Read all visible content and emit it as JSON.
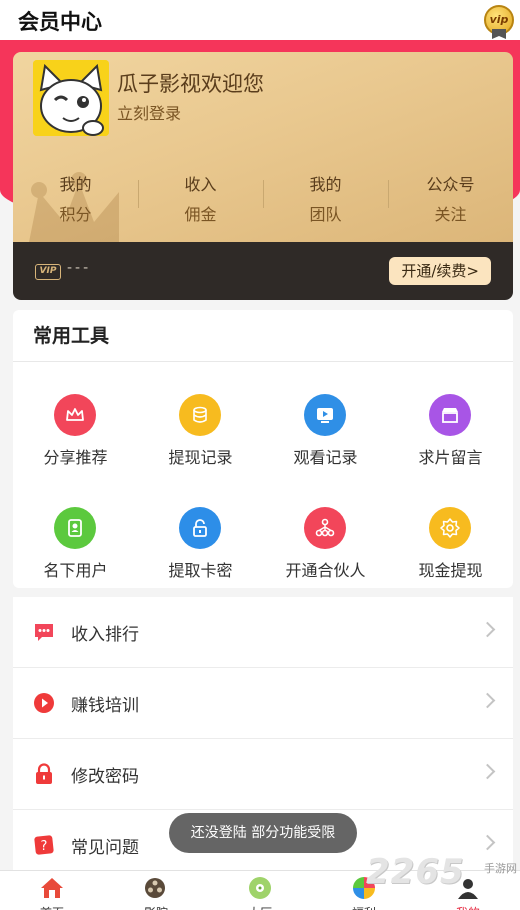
{
  "header": {
    "title": "会员中心",
    "vip_badge": "vip"
  },
  "profile": {
    "welcome": "瓜子影视欢迎您",
    "login": "立刻登录",
    "stats": [
      {
        "line1": "我的",
        "line2": "积分"
      },
      {
        "line1": "收入",
        "line2": "佣金"
      },
      {
        "line1": "我的",
        "line2": "团队"
      },
      {
        "line1": "公众号",
        "line2": "关注"
      }
    ],
    "vip_tag": "VIP",
    "vip_status": "---",
    "open_button": "开通/续费>"
  },
  "tools": {
    "title": "常用工具",
    "items": [
      {
        "label": "分享推荐",
        "icon": "crown-icon",
        "color": "#f2465a"
      },
      {
        "label": "提现记录",
        "icon": "coins-icon",
        "color": "#f7bb1f"
      },
      {
        "label": "观看记录",
        "icon": "tv-icon",
        "color": "#2f8fe6"
      },
      {
        "label": "求片留言",
        "icon": "store-icon",
        "color": "#a855e6"
      },
      {
        "label": "名下用户",
        "icon": "user-card-icon",
        "color": "#5cc93e"
      },
      {
        "label": "提取卡密",
        "icon": "unlock-icon",
        "color": "#2d8ee8"
      },
      {
        "label": "开通合伙人",
        "icon": "network-icon",
        "color": "#f2465a"
      },
      {
        "label": "现金提现",
        "icon": "gear-icon",
        "color": "#f7bb1f"
      }
    ]
  },
  "menu": [
    {
      "label": "收入排行",
      "icon": "chat-icon",
      "color": "#f2465a"
    },
    {
      "label": "赚钱培训",
      "icon": "play-icon",
      "color": "#ef3a3a"
    },
    {
      "label": "修改密码",
      "icon": "lock-icon",
      "color": "#ef3a3a"
    },
    {
      "label": "常见问题",
      "icon": "help-icon",
      "color": "#ef3a3a"
    }
  ],
  "toast": "还没登陆 部分功能受限",
  "tabs": [
    {
      "label": "首页",
      "icon": "home-icon"
    },
    {
      "label": "影院",
      "icon": "film-reel-icon"
    },
    {
      "label": "大厅",
      "icon": "disc-icon"
    },
    {
      "label": "福利",
      "icon": "gift-ball-icon"
    },
    {
      "label": "我的",
      "icon": "profile-icon",
      "active": true
    }
  ],
  "watermark": {
    "number": "2265",
    "sub": "手游网"
  }
}
